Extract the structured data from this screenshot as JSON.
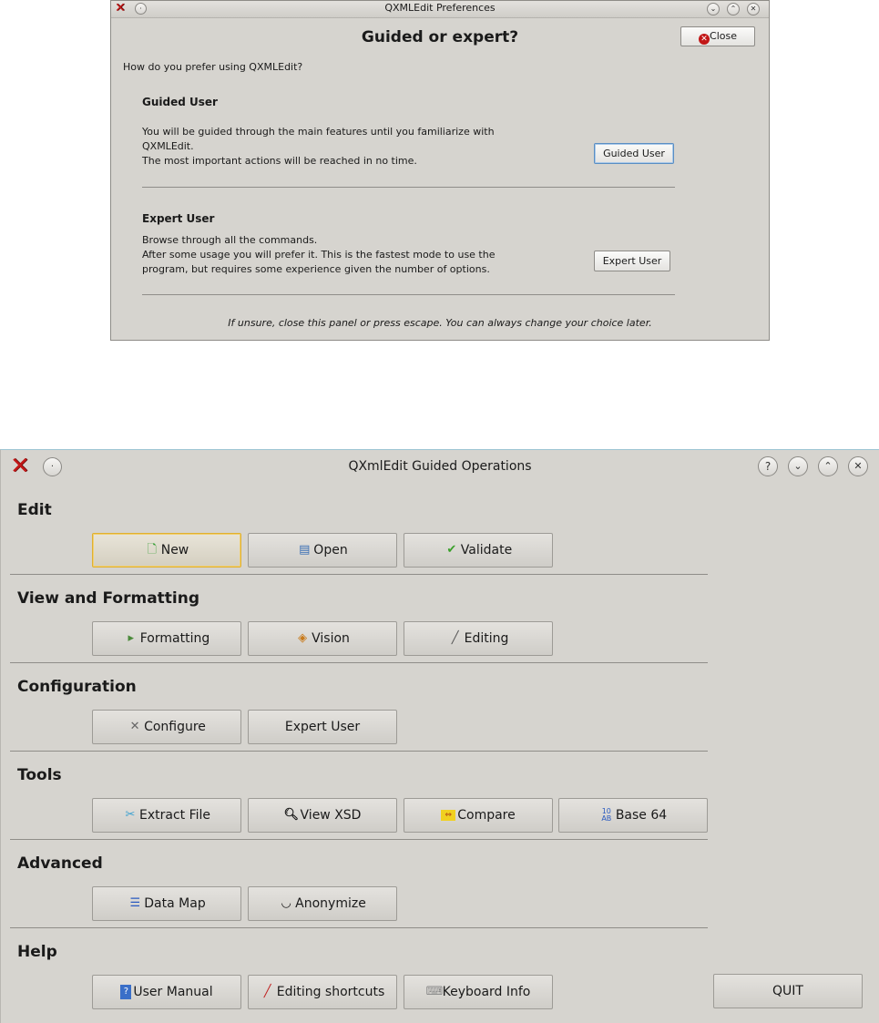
{
  "prefs": {
    "window_title": "QXMLEdit Preferences",
    "heading": "Guided or expert?",
    "close_label": "Close",
    "question": "How do you prefer using QXMLEdit?",
    "guided": {
      "title": "Guided User",
      "line1": "You will be guided through the main features until you familiarize with",
      "line2": "QXMLEdit.",
      "line3": "The most important actions will be reached in no time.",
      "button": "Guided User"
    },
    "expert": {
      "title": "Expert User",
      "line1": "Browse through all the commands.",
      "line2": "After some usage you will prefer it. This is the fastest mode to use the",
      "line3": "program, but requires some experience given the number of options.",
      "button": "Expert User"
    },
    "footer": "If unsure, close this panel or press escape. You can always change your choice later."
  },
  "guided": {
    "window_title": "QXmlEdit Guided Operations",
    "sections": {
      "edit": {
        "title": "Edit",
        "new": "New",
        "open": "Open",
        "validate": "Validate"
      },
      "view": {
        "title": "View and Formatting",
        "formatting": "Formatting",
        "vision": "Vision",
        "editing": "Editing"
      },
      "config": {
        "title": "Configuration",
        "configure": "Configure",
        "expert": "Expert User"
      },
      "tools": {
        "title": "Tools",
        "extract": "Extract File",
        "viewxsd": "View XSD",
        "compare": "Compare",
        "base64": "Base 64"
      },
      "advanced": {
        "title": "Advanced",
        "datamap": "Data Map",
        "anonymize": "Anonymize"
      },
      "help": {
        "title": "Help",
        "manual": "User Manual",
        "shortcuts": "Editing shortcuts",
        "keyboard": "Keyboard Info"
      }
    },
    "quit": "QUIT"
  },
  "colors": {
    "window_bg": "#d6d4cf",
    "focus_border": "#e0b030",
    "close_red": "#c21717",
    "validate_green": "#3aa02a"
  }
}
